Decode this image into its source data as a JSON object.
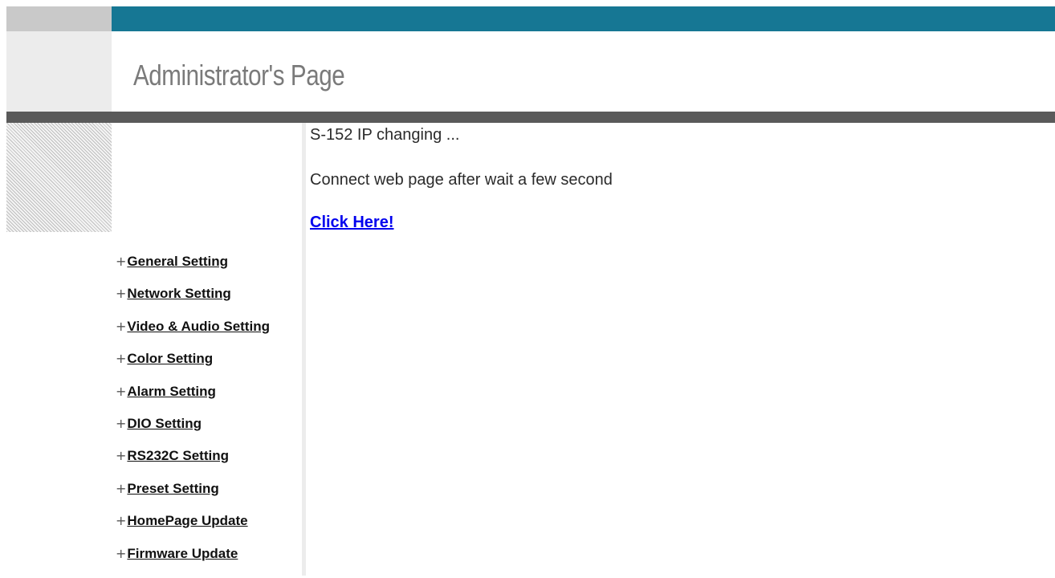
{
  "header": {
    "title": "Administrator's Page"
  },
  "main": {
    "status_line": "S-152 IP changing ...",
    "instruction_line": "Connect web page after wait a few second",
    "link_label": "Click Here!"
  },
  "sidebar": {
    "items": [
      {
        "label": "General Setting"
      },
      {
        "label": "Network Setting"
      },
      {
        "label": "Video & Audio Setting"
      },
      {
        "label": "Color Setting"
      },
      {
        "label": "Alarm Setting"
      },
      {
        "label": "DIO Setting"
      },
      {
        "label": "RS232C Setting"
      },
      {
        "label": "Preset Setting"
      },
      {
        "label": "HomePage Update"
      },
      {
        "label": "Firmware Update"
      }
    ],
    "bullet": "+"
  },
  "colors": {
    "top_bar": "#167794",
    "dark_bar": "#5a5a5a",
    "title_text": "#7a7a7a",
    "link": "#0000ee"
  }
}
